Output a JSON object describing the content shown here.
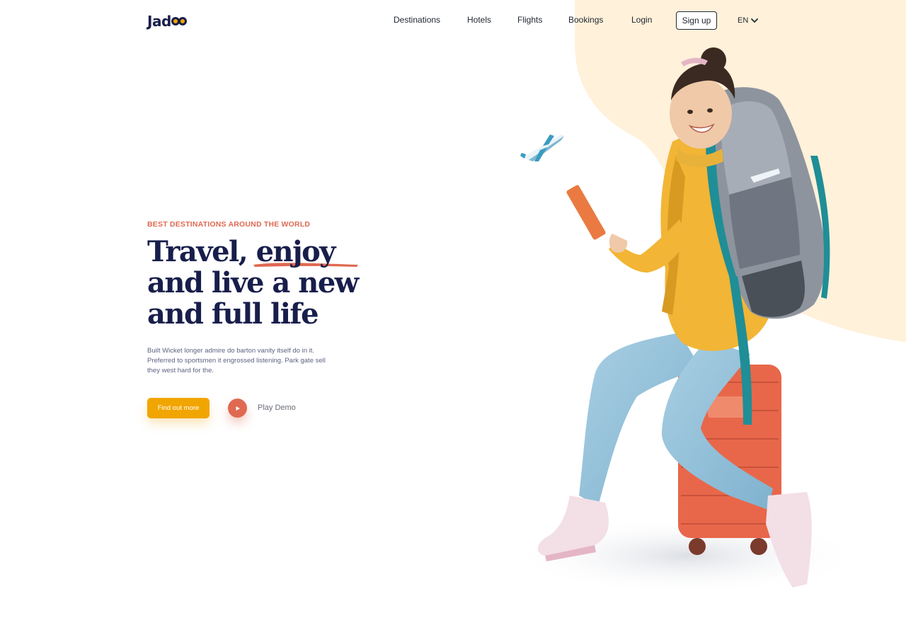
{
  "brand": {
    "name_prefix": "Jad",
    "accent": "#f1a501",
    "navy": "#181e4b"
  },
  "nav": {
    "items": [
      {
        "label": "Destinations"
      },
      {
        "label": "Hotels"
      },
      {
        "label": "Flights"
      },
      {
        "label": "Bookings"
      },
      {
        "label": "Login"
      }
    ],
    "signup_label": "Sign up",
    "language": "EN",
    "language_icon": "chevron-down-icon"
  },
  "hero": {
    "eyebrow": "BEST DESTINATIONS AROUND THE WORLD",
    "headline_part1": "Travel, ",
    "headline_highlight": "enjoy",
    "headline_line2": "and live a new",
    "headline_line3": "and full life",
    "description": "Built Wicket longer admire do barton vanity itself do in it. Preferred to sportsmen it engrossed listening. Park gate sell they west hard for the.",
    "cta_label": "Find out more",
    "play_label": "Play Demo",
    "play_icon": "play-icon",
    "colors": {
      "eyebrow": "#df6951",
      "cta": "#f1a501",
      "play": "#df6951",
      "blob": "#fff1da"
    }
  }
}
